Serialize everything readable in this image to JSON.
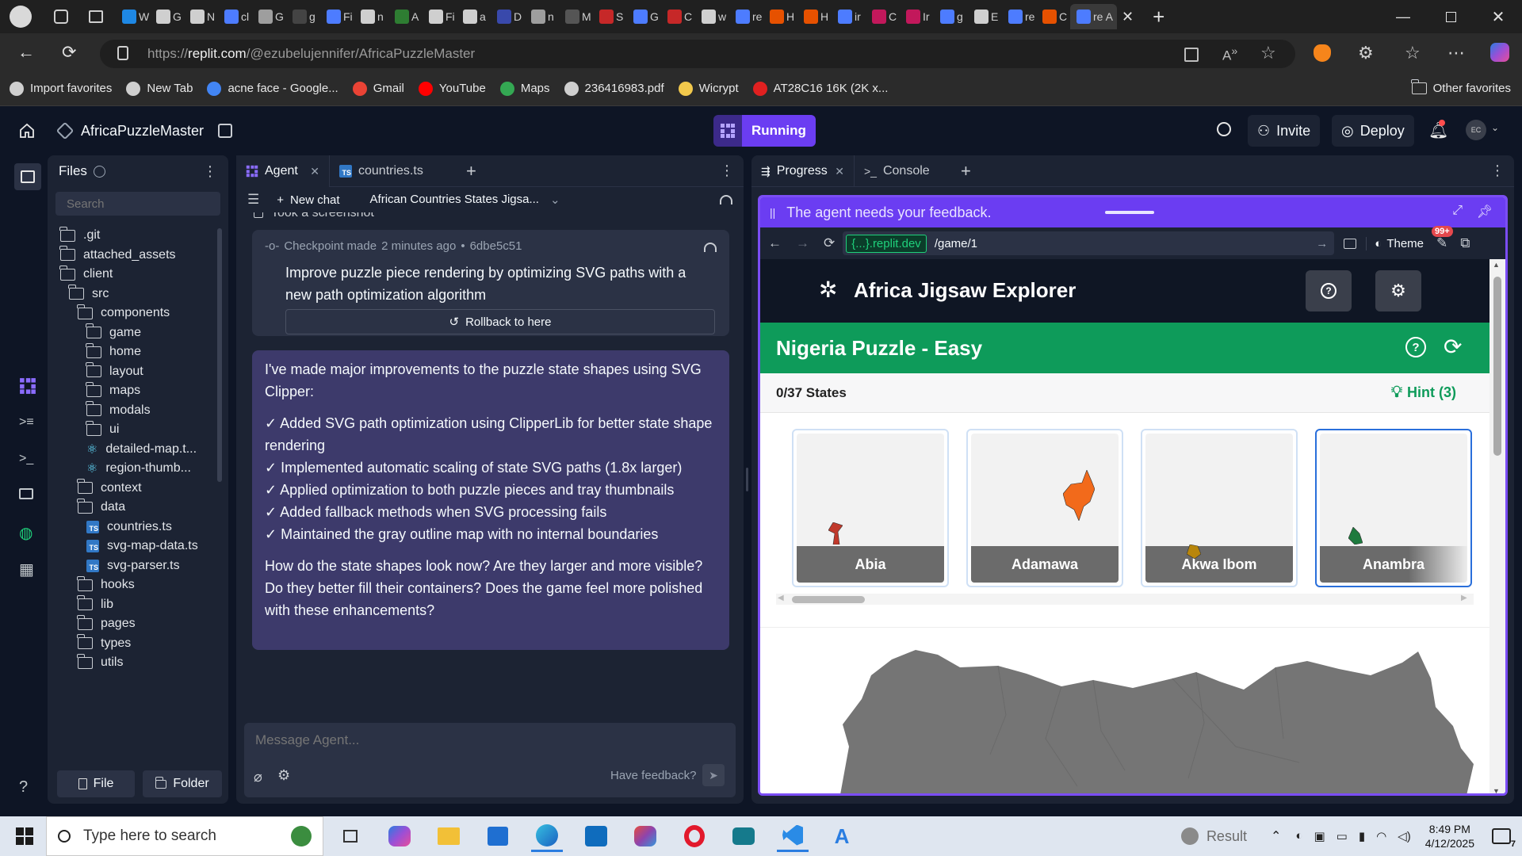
{
  "browser": {
    "tab_labels": [
      "W",
      "G",
      "N",
      "cl",
      "G",
      "g",
      "Fi",
      "n",
      "A",
      "Fi",
      "a",
      "D",
      "n",
      "M",
      "S",
      "G",
      "C",
      "w",
      "re",
      "H",
      "H",
      "ir",
      "C",
      "Ir",
      "g",
      "E",
      "re",
      "C",
      "re A"
    ],
    "url_prefix": "https://",
    "url_host": "replit.com",
    "url_path": "/@ezubelujennifer/AfricaPuzzleMaster",
    "bookmarks": [
      {
        "label": "Import favorites",
        "icon": "import-icon",
        "color": "#cfcfcf"
      },
      {
        "label": "New Tab",
        "icon": "globe-icon",
        "color": "#cfcfcf"
      },
      {
        "label": "acne face - Google...",
        "icon": "google-icon",
        "color": "#4285f4"
      },
      {
        "label": "Gmail",
        "icon": "gmail-icon",
        "color": "#ea4335"
      },
      {
        "label": "YouTube",
        "icon": "youtube-icon",
        "color": "#ff0000"
      },
      {
        "label": "Maps",
        "icon": "maps-icon",
        "color": "#34a853"
      },
      {
        "label": "236416983.pdf",
        "icon": "globe-icon",
        "color": "#cfcfcf"
      },
      {
        "label": "Wicrypt",
        "icon": "wicrypt-icon",
        "color": "#f2c94c"
      },
      {
        "label": "AT28C16 16K (2K x...",
        "icon": "pattern-icon",
        "color": "#e02020"
      }
    ],
    "other_favorites": "Other favorites"
  },
  "header": {
    "project_name": "AfricaPuzzleMaster",
    "run_status": "Running",
    "invite": "Invite",
    "deploy": "Deploy",
    "avatar_initials": "EC"
  },
  "files": {
    "title": "Files",
    "search_placeholder": "Search",
    "tree": [
      {
        "name": ".git",
        "type": "folder",
        "depth": 0
      },
      {
        "name": "attached_assets",
        "type": "folder",
        "depth": 0
      },
      {
        "name": "client",
        "type": "folder-open",
        "depth": 0
      },
      {
        "name": "src",
        "type": "folder-open",
        "depth": 1
      },
      {
        "name": "components",
        "type": "folder-open",
        "depth": 2
      },
      {
        "name": "game",
        "type": "folder",
        "depth": 3
      },
      {
        "name": "home",
        "type": "folder",
        "depth": 3
      },
      {
        "name": "layout",
        "type": "folder",
        "depth": 3
      },
      {
        "name": "maps",
        "type": "folder",
        "depth": 3
      },
      {
        "name": "modals",
        "type": "folder",
        "depth": 3
      },
      {
        "name": "ui",
        "type": "folder",
        "depth": 3
      },
      {
        "name": "detailed-map.t...",
        "type": "react",
        "depth": 3
      },
      {
        "name": "region-thumb...",
        "type": "react",
        "depth": 3
      },
      {
        "name": "context",
        "type": "folder",
        "depth": 2
      },
      {
        "name": "data",
        "type": "folder-open",
        "depth": 2
      },
      {
        "name": "countries.ts",
        "type": "ts",
        "depth": 3
      },
      {
        "name": "svg-map-data.ts",
        "type": "ts",
        "depth": 3
      },
      {
        "name": "svg-parser.ts",
        "type": "ts",
        "depth": 3
      },
      {
        "name": "hooks",
        "type": "folder",
        "depth": 2
      },
      {
        "name": "lib",
        "type": "folder",
        "depth": 2
      },
      {
        "name": "pages",
        "type": "folder",
        "depth": 2
      },
      {
        "name": "types",
        "type": "folder",
        "depth": 2
      },
      {
        "name": "utils",
        "type": "folder",
        "depth": 2
      }
    ],
    "new_file": "File",
    "new_folder": "Folder"
  },
  "agent": {
    "tab_agent": "Agent",
    "tab_file": "countries.ts",
    "new_chat": "New chat",
    "chat_title": "African Countries States Jigsa...",
    "partial_above": "Took a screenshot",
    "checkpoint_label": "Checkpoint made",
    "checkpoint_time": "2 minutes ago",
    "checkpoint_hash": "6dbe5c51",
    "checkpoint_text": "Improve puzzle piece rendering by optimizing SVG paths with a new path optimization algorithm",
    "rollback": "Rollback to here",
    "message_intro": "I've made major improvements to the puzzle state shapes using SVG Clipper:",
    "message_bullets": [
      "✓ Added SVG path optimization using ClipperLib for better state shape rendering",
      "✓ Implemented automatic scaling of state SVG paths (1.8x larger)",
      "✓ Applied optimization to both puzzle pieces and tray thumbnails",
      "✓ Added fallback methods when SVG processing fails",
      "✓ Maintained the gray outline map with no internal boundaries"
    ],
    "message_question": "How do the state shapes look now? Are they larger and more visible? Do they better fill their containers? Does the game feel more polished with these enhancements?",
    "input_placeholder": "Message Agent...",
    "feedback": "Have feedback?"
  },
  "progress": {
    "tab_progress": "Progress",
    "tab_console": "Console",
    "feedback_banner": "The agent needs your feedback.",
    "url_host": "{...}.replit.dev",
    "url_path": "/game/1",
    "theme": "Theme",
    "badge": "99+"
  },
  "game": {
    "app_title": "Africa Jigsaw Explorer",
    "puzzle_title": "Nigeria Puzzle - Easy",
    "states_progress": "0/37 States",
    "hint": "Hint (3)",
    "pieces": [
      {
        "name": "Abia",
        "color": "#c0392b"
      },
      {
        "name": "Adamawa",
        "color": "#f26a1b"
      },
      {
        "name": "Akwa Ibom",
        "color": "#b8860b"
      },
      {
        "name": "Anambra",
        "color": "#1e7a3e"
      }
    ],
    "header_bg": "#0f1624",
    "banner_bg": "#0e9b5a",
    "map_color": "#757575"
  },
  "taskbar": {
    "search_placeholder": "Type here to search",
    "weather": "Result",
    "time": "8:49 PM",
    "date": "4/12/2025",
    "notifications": "7"
  }
}
